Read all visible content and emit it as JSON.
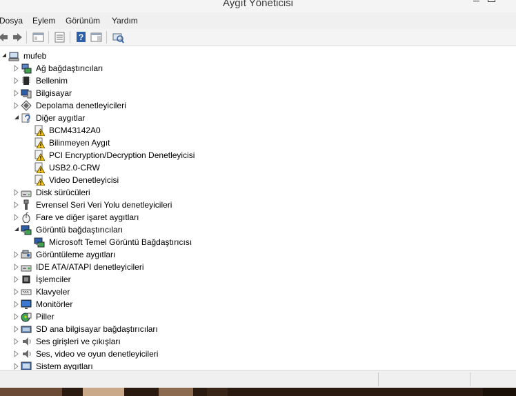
{
  "window": {
    "title": "Aygıt Yöneticisi"
  },
  "menu": {
    "items": [
      "Dosya",
      "Eylem",
      "Görünüm",
      "Yardım"
    ]
  },
  "tree": {
    "root": "mufeb",
    "categories": [
      {
        "label": "Ağ bağdaştırıcıları",
        "icon": "network-adapter-icon",
        "expanded": false,
        "children": []
      },
      {
        "label": "Bellenim",
        "icon": "firmware-chip-icon",
        "expanded": false,
        "children": []
      },
      {
        "label": "Bilgisayar",
        "icon": "computer-icon",
        "expanded": false,
        "children": []
      },
      {
        "label": "Depolama denetleyicileri",
        "icon": "storage-controller-icon",
        "expanded": false,
        "children": []
      },
      {
        "label": "Diğer aygıtlar",
        "icon": "unknown-device-icon",
        "expanded": true,
        "children": [
          {
            "label": "BCM43142A0",
            "icon": "warning-device-icon"
          },
          {
            "label": "Bilinmeyen Aygıt",
            "icon": "warning-device-icon"
          },
          {
            "label": "PCI Encryption/Decryption Denetleyicisi",
            "icon": "warning-device-icon"
          },
          {
            "label": "USB2.0-CRW",
            "icon": "warning-device-icon"
          },
          {
            "label": "Video Denetleyicisi",
            "icon": "warning-device-icon"
          }
        ]
      },
      {
        "label": "Disk sürücüleri",
        "icon": "disk-drive-icon",
        "expanded": false,
        "children": []
      },
      {
        "label": "Evrensel Seri Veri Yolu denetleyicileri",
        "icon": "usb-icon",
        "expanded": false,
        "children": []
      },
      {
        "label": "Fare ve diğer işaret aygıtları",
        "icon": "mouse-icon",
        "expanded": false,
        "children": []
      },
      {
        "label": "Görüntü bağdaştırıcıları",
        "icon": "display-adapter-icon",
        "expanded": true,
        "children": [
          {
            "label": "Microsoft Temel Görüntü Bağdaştırıcısı",
            "icon": "display-adapter-icon"
          }
        ]
      },
      {
        "label": "Görüntüleme aygıtları",
        "icon": "imaging-device-icon",
        "expanded": false,
        "children": []
      },
      {
        "label": "IDE ATA/ATAPI denetleyicileri",
        "icon": "ide-controller-icon",
        "expanded": false,
        "children": []
      },
      {
        "label": "İşlemciler",
        "icon": "processor-icon",
        "expanded": false,
        "children": []
      },
      {
        "label": "Klavyeler",
        "icon": "keyboard-icon",
        "expanded": false,
        "children": []
      },
      {
        "label": "Monitörler",
        "icon": "monitor-icon",
        "expanded": false,
        "children": []
      },
      {
        "label": "Piller",
        "icon": "battery-icon",
        "expanded": false,
        "children": []
      },
      {
        "label": "SD ana bilgisayar bağdaştırıcıları",
        "icon": "sd-host-icon",
        "expanded": false,
        "children": []
      },
      {
        "label": "Ses girişleri ve çıkışları",
        "icon": "speaker-icon",
        "expanded": false,
        "children": []
      },
      {
        "label": "Ses, video ve oyun denetleyicileri",
        "icon": "speaker-icon",
        "expanded": false,
        "children": []
      },
      {
        "label": "Sistem aygıtları",
        "icon": "system-device-icon",
        "expanded": false,
        "children": []
      }
    ]
  }
}
